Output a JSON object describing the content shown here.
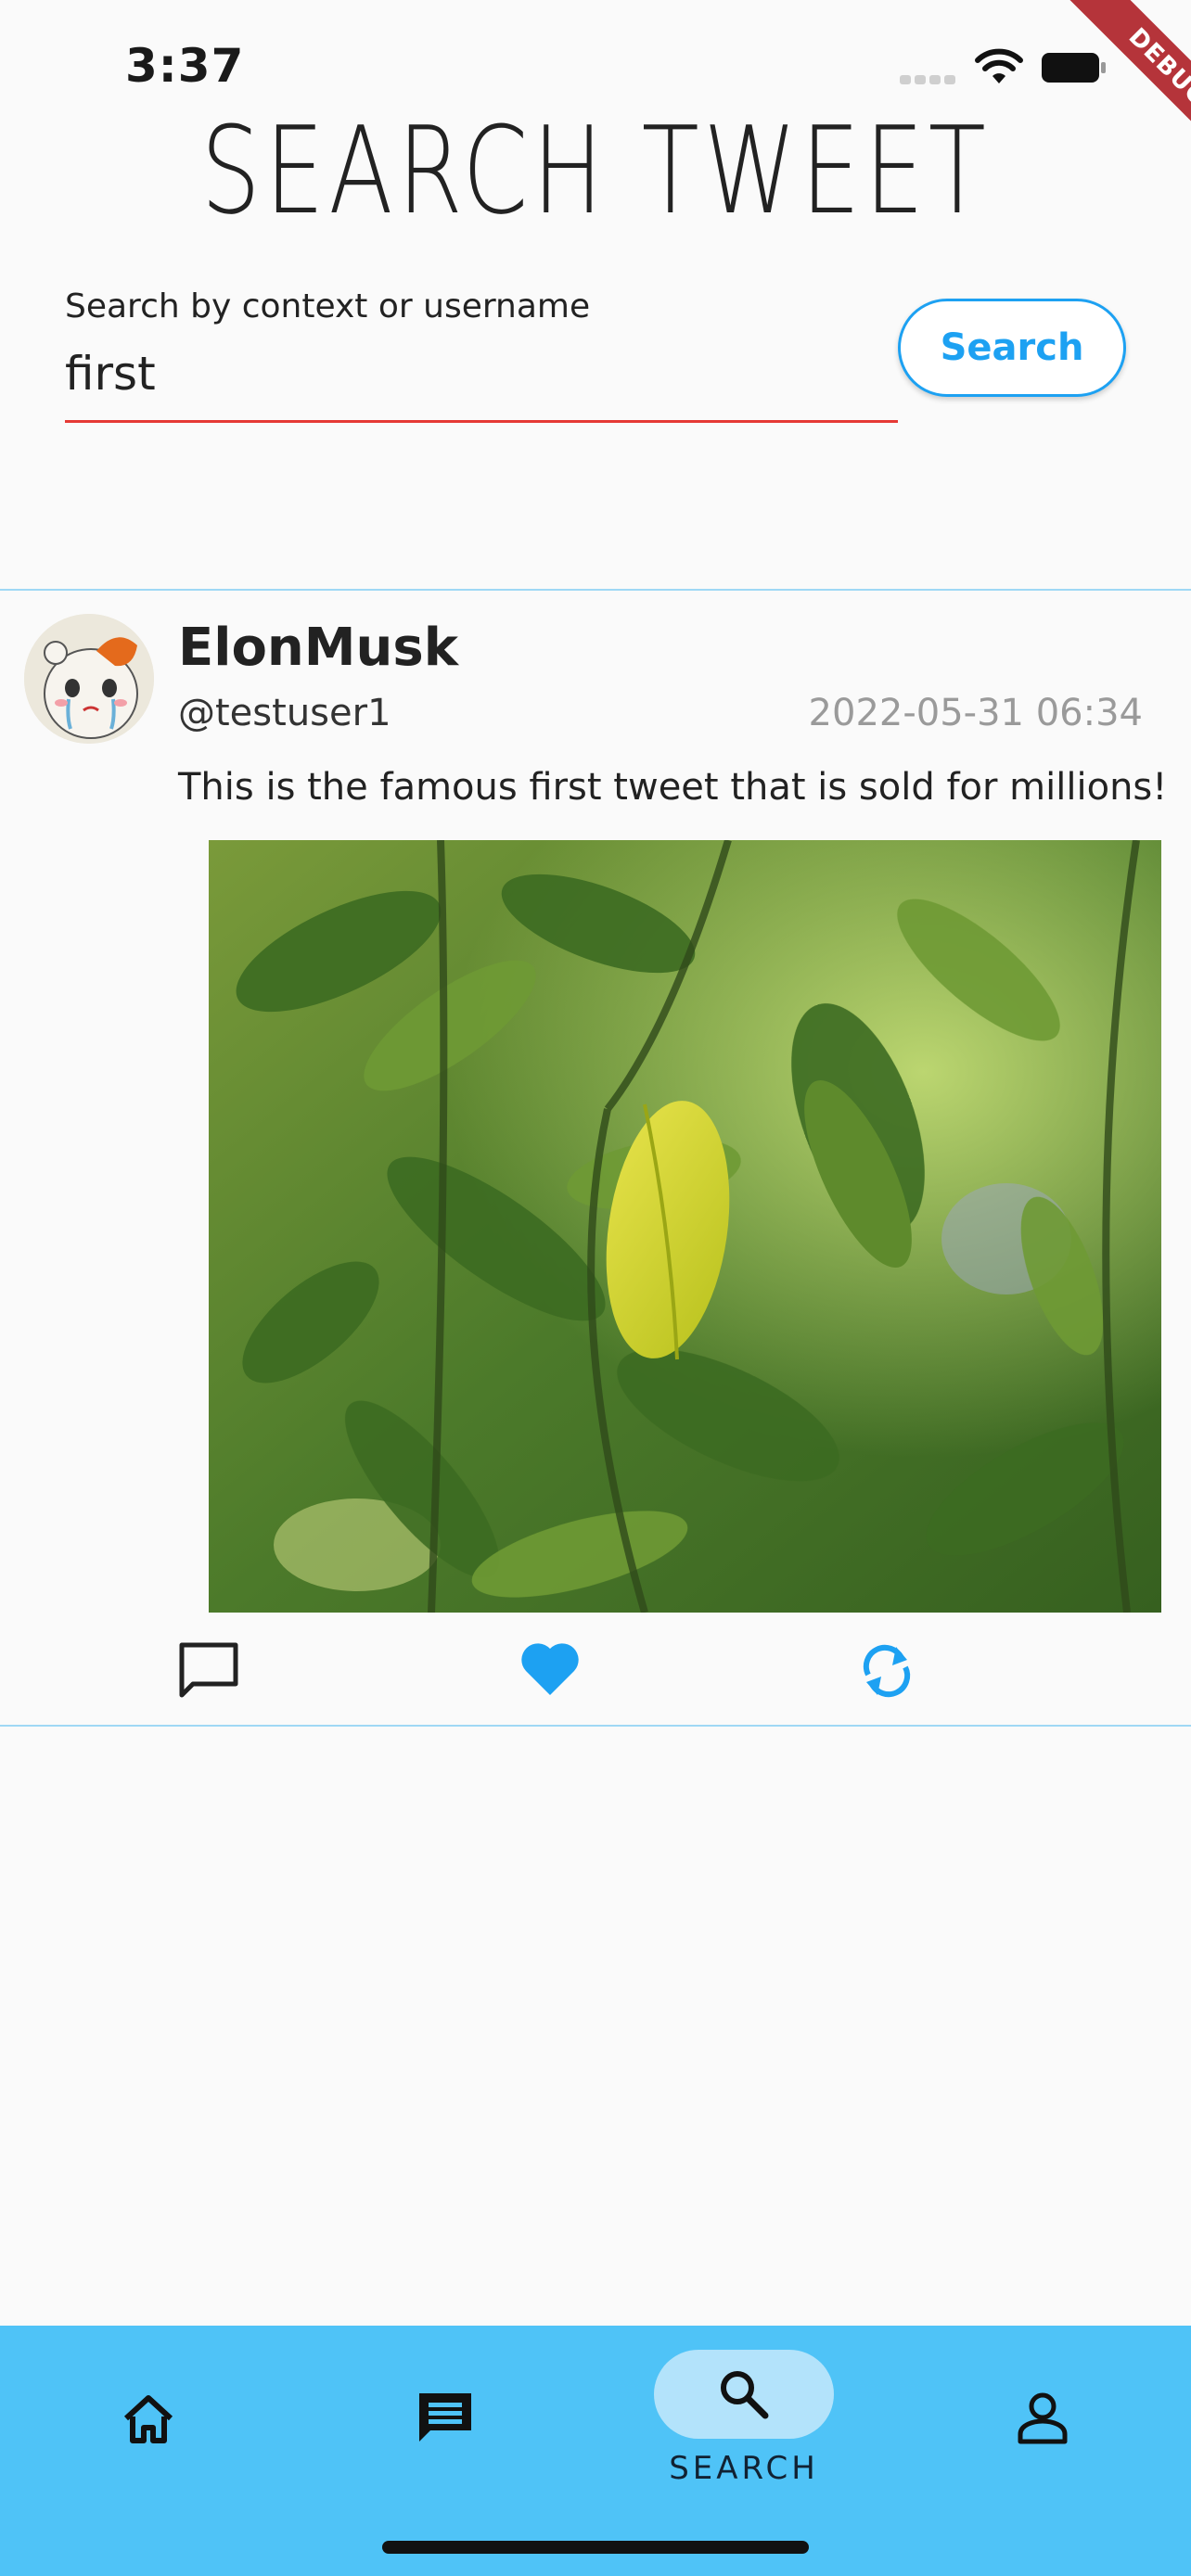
{
  "status_bar": {
    "time": "3:37"
  },
  "debug_banner": "DEBUG",
  "page_title": "SEARCH TWEET",
  "search": {
    "label": "Search by context or username",
    "value": "first",
    "button_label": "Search"
  },
  "tweet": {
    "name": "ElonMusk",
    "handle": "@testuser1",
    "date": "2022-05-31 06:34",
    "text": "This is the famous first tweet that is sold for millions!",
    "liked": true
  },
  "bottom_nav": {
    "items": [
      {
        "icon": "home-icon",
        "label": ""
      },
      {
        "icon": "message-icon",
        "label": ""
      },
      {
        "icon": "search-icon",
        "label": "SEARCH",
        "active": true
      },
      {
        "icon": "profile-icon",
        "label": ""
      }
    ]
  },
  "colors": {
    "accent": "#1da1f2",
    "nav_background": "#4fc3f7",
    "nav_active_pill": "#b3e3fb",
    "input_underline": "#e53935",
    "divider": "#9fd8f5",
    "debug_ribbon": "#b5343a"
  }
}
